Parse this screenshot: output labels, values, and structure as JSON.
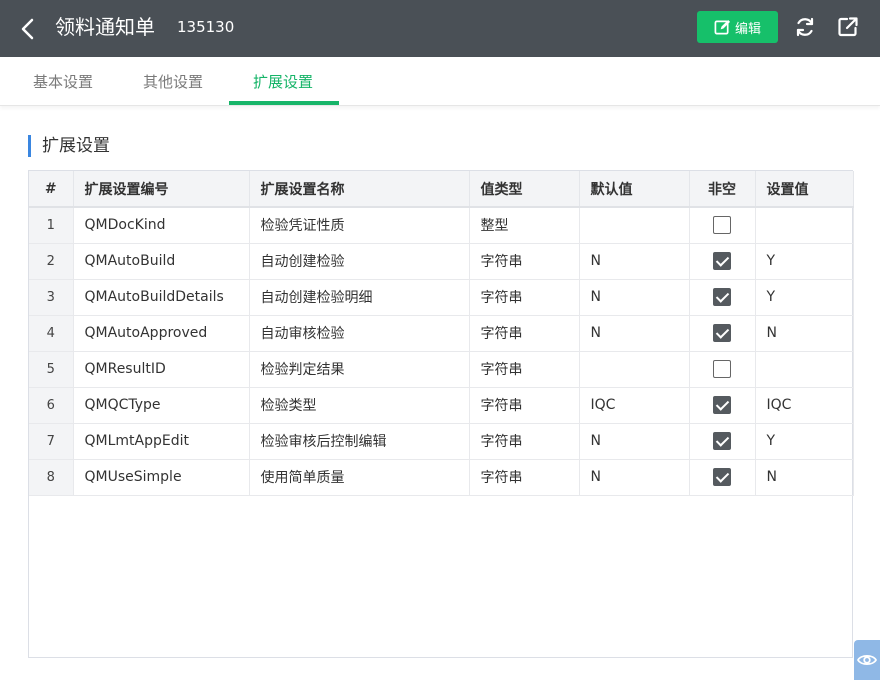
{
  "header": {
    "title": "领料通知单",
    "doc_number": "135130",
    "edit_label": "编辑",
    "icons": [
      "back-icon",
      "edit-icon",
      "refresh-icon",
      "share-icon"
    ]
  },
  "tabs": [
    {
      "label": "基本设置",
      "active": false
    },
    {
      "label": "其他设置",
      "active": false
    },
    {
      "label": "扩展设置",
      "active": true
    }
  ],
  "section": {
    "title": "扩展设置"
  },
  "table": {
    "columns": [
      "#",
      "扩展设置编号",
      "扩展设置名称",
      "值类型",
      "默认值",
      "非空",
      "设置值"
    ],
    "rows": [
      {
        "idx": "1",
        "code": "QMDocKind",
        "name": "检验凭证性质",
        "type": "整型",
        "default": "",
        "required": false,
        "value": ""
      },
      {
        "idx": "2",
        "code": "QMAutoBuild",
        "name": "自动创建检验",
        "type": "字符串",
        "default": "N",
        "required": true,
        "value": "Y"
      },
      {
        "idx": "3",
        "code": "QMAutoBuildDetails",
        "name": "自动创建检验明细",
        "type": "字符串",
        "default": "N",
        "required": true,
        "value": "Y"
      },
      {
        "idx": "4",
        "code": "QMAutoApproved",
        "name": "自动审核检验",
        "type": "字符串",
        "default": "N",
        "required": true,
        "value": "N"
      },
      {
        "idx": "5",
        "code": "QMResultID",
        "name": "检验判定结果",
        "type": "字符串",
        "default": "",
        "required": false,
        "value": ""
      },
      {
        "idx": "6",
        "code": "QMQCType",
        "name": "检验类型",
        "type": "字符串",
        "default": "IQC",
        "required": true,
        "value": "IQC"
      },
      {
        "idx": "7",
        "code": "QMLmtAppEdit",
        "name": "检验审核后控制编辑",
        "type": "字符串",
        "default": "N",
        "required": true,
        "value": "Y"
      },
      {
        "idx": "8",
        "code": "QMUseSimple",
        "name": "使用简单质量",
        "type": "字符串",
        "default": "N",
        "required": true,
        "value": "N"
      }
    ]
  },
  "colors": {
    "header_bg": "#4a5056",
    "accent_green": "#16b468",
    "section_bar": "#3a86e0"
  }
}
